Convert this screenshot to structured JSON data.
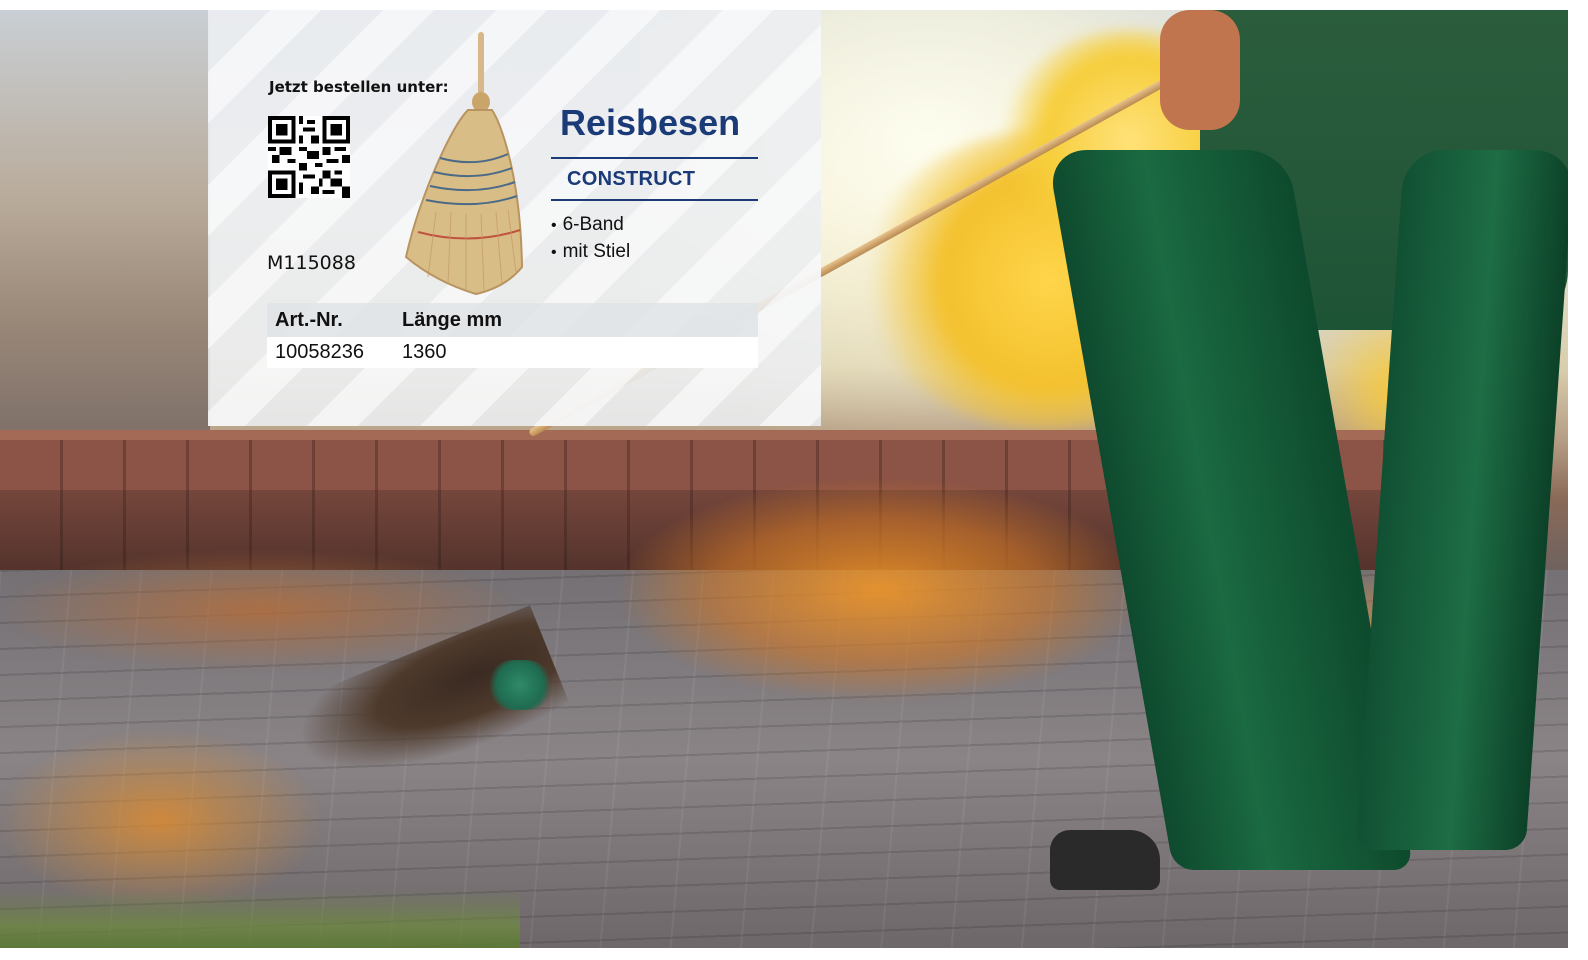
{
  "card": {
    "order_label": "Jetzt bestellen unter:",
    "model_number": "M115088",
    "product_title": "Reisbesen",
    "brand": "CONSTRUCT",
    "features": [
      "6-Band",
      "mit Stiel"
    ],
    "table": {
      "headers": [
        "Art.-Nr.",
        "Länge mm"
      ],
      "rows": [
        [
          "10058236",
          "1360"
        ]
      ]
    }
  },
  "colors": {
    "title_blue": "#1a3a78",
    "pants_green": "#1a6a42"
  }
}
